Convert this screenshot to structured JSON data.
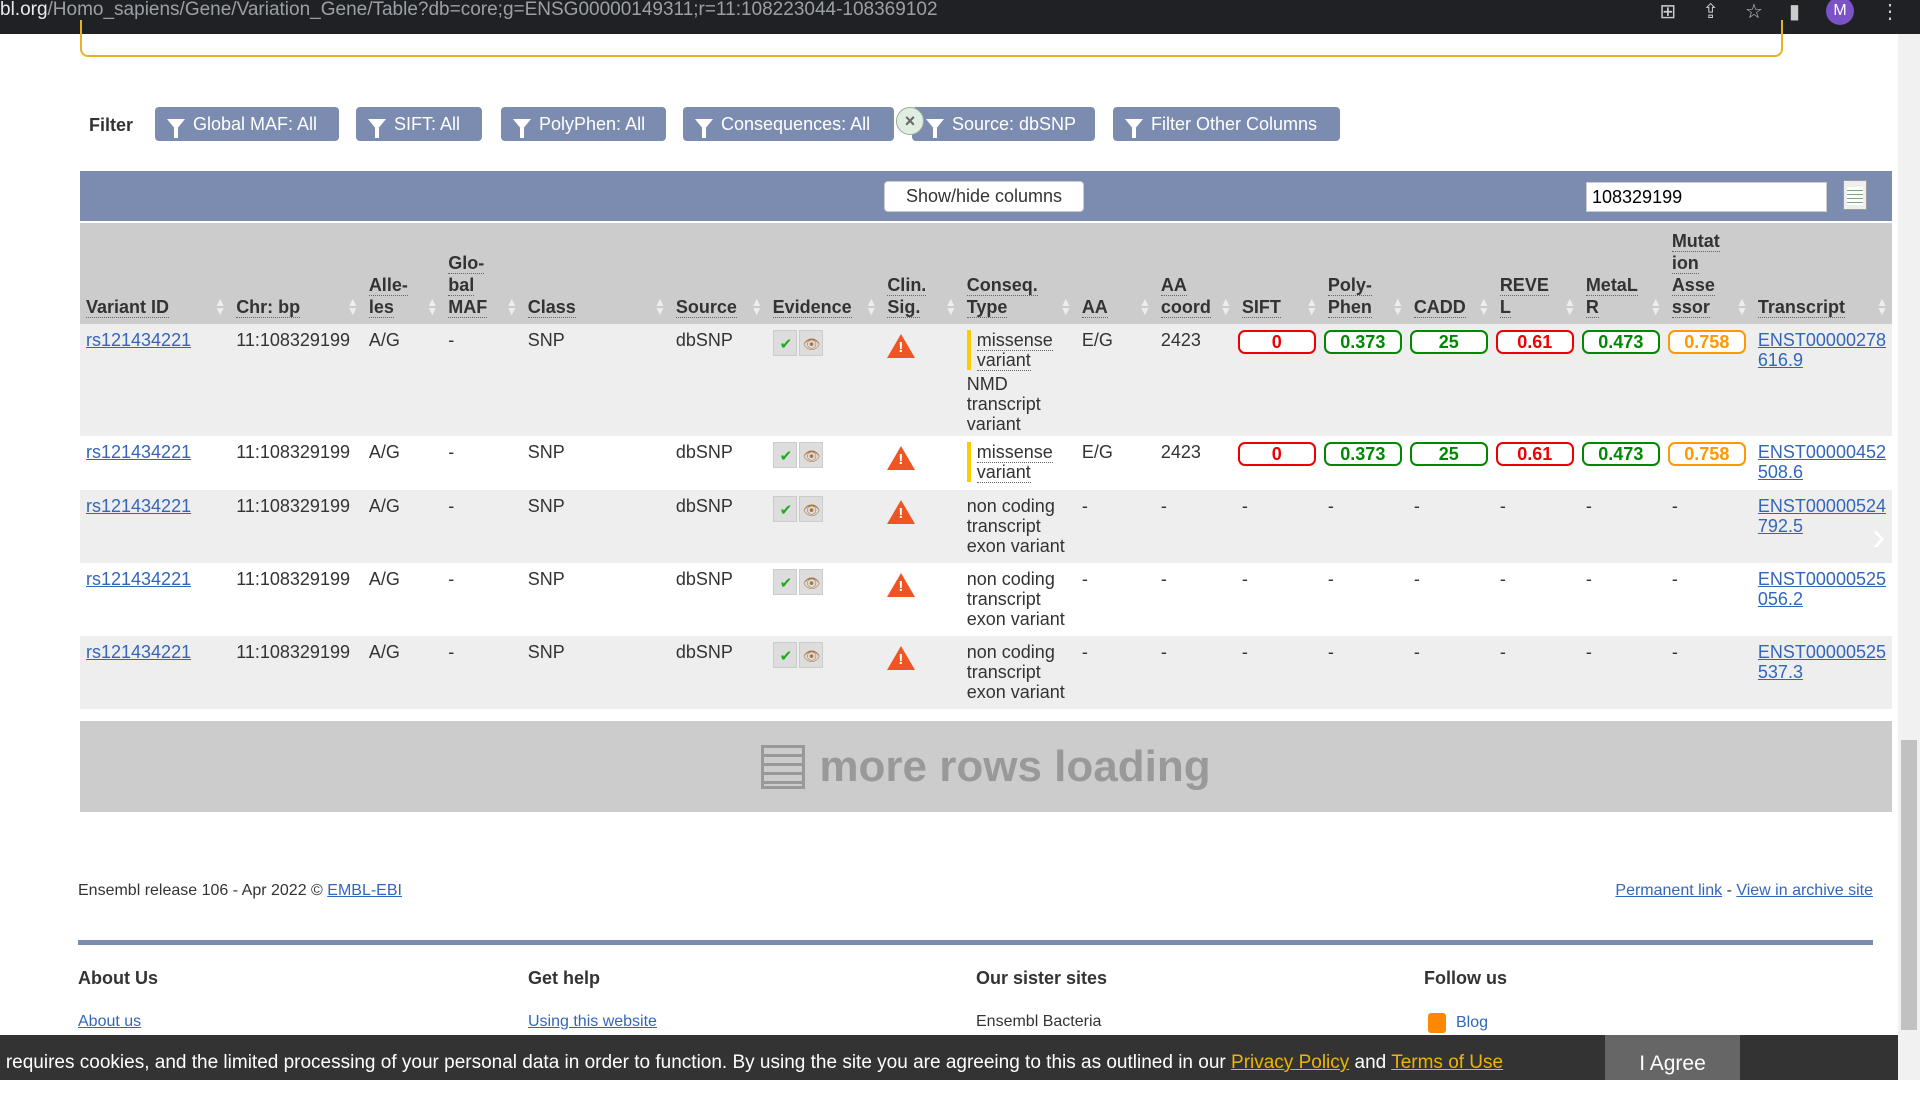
{
  "browser": {
    "url_host": "bl.org",
    "url_path": "/Homo_sapiens/Gene/Variation_Gene/Table?db=core;g=ENSG00000149311;r=11:108223044-108369102",
    "avatar": "M"
  },
  "filter": {
    "label": "Filter",
    "buttons": [
      "Global MAF: All",
      "SIFT: All",
      "PolyPhen: All",
      "Consequences: All",
      "Source: dbSNP",
      "Filter Other Columns"
    ]
  },
  "toolbar": {
    "show_hide": "Show/hide columns",
    "search_value": "108329199"
  },
  "table": {
    "headers": [
      [
        "Variant ID"
      ],
      [
        "Chr: bp"
      ],
      [
        "Alle-",
        "les"
      ],
      [
        "Glo-",
        "bal",
        "MAF"
      ],
      [
        "Class"
      ],
      [
        "Source"
      ],
      [
        "Evidence"
      ],
      [
        "Clin.",
        "Sig."
      ],
      [
        "Conseq.",
        "Type"
      ],
      [
        "AA"
      ],
      [
        "AA",
        "coord"
      ],
      [
        "SIFT"
      ],
      [
        "Poly-",
        "Phen"
      ],
      [
        "CADD"
      ],
      [
        "REVE",
        "L"
      ],
      [
        "MetaL",
        "R"
      ],
      [
        "Mutat",
        "ion",
        "Asse",
        "ssor"
      ],
      [
        "Transcript"
      ]
    ],
    "rows": [
      {
        "id": "rs121434221",
        "chr": "11:108329199",
        "alleles": "A/G",
        "maf": "-",
        "class": "SNP",
        "source": "dbSNP",
        "conseq": [
          "missense variant"
        ],
        "conseq_extra": "NMD transcript variant",
        "aa": "E/G",
        "aa_coord": "2423",
        "sift": "0",
        "polyphen": "0.373",
        "cadd": "25",
        "revel": "0.61",
        "metalr": "0.473",
        "ma": "0.758",
        "transcript": [
          "ENST00000278",
          "616.9"
        ]
      },
      {
        "id": "rs121434221",
        "chr": "11:108329199",
        "alleles": "A/G",
        "maf": "-",
        "class": "SNP",
        "source": "dbSNP",
        "conseq": [
          "missense variant"
        ],
        "conseq_extra": "",
        "aa": "E/G",
        "aa_coord": "2423",
        "sift": "0",
        "polyphen": "0.373",
        "cadd": "25",
        "revel": "0.61",
        "metalr": "0.473",
        "ma": "0.758",
        "transcript": [
          "ENST00000452",
          "508.6"
        ]
      },
      {
        "id": "rs121434221",
        "chr": "11:108329199",
        "alleles": "A/G",
        "maf": "-",
        "class": "SNP",
        "source": "dbSNP",
        "conseq_plain": "non coding transcript exon variant",
        "aa": "-",
        "aa_coord": "-",
        "sift": "-",
        "polyphen": "-",
        "cadd": "-",
        "revel": "-",
        "metalr": "-",
        "ma": "-",
        "transcript": [
          "ENST00000524",
          "792.5"
        ]
      },
      {
        "id": "rs121434221",
        "chr": "11:108329199",
        "alleles": "A/G",
        "maf": "-",
        "class": "SNP",
        "source": "dbSNP",
        "conseq_plain": "non coding transcript exon variant",
        "aa": "-",
        "aa_coord": "-",
        "sift": "-",
        "polyphen": "-",
        "cadd": "-",
        "revel": "-",
        "metalr": "-",
        "ma": "-",
        "transcript": [
          "ENST00000525",
          "056.2"
        ]
      },
      {
        "id": "rs121434221",
        "chr": "11:108329199",
        "alleles": "A/G",
        "maf": "-",
        "class": "SNP",
        "source": "dbSNP",
        "conseq_plain": "non coding transcript exon variant",
        "aa": "-",
        "aa_coord": "-",
        "sift": "-",
        "polyphen": "-",
        "cadd": "-",
        "revel": "-",
        "metalr": "-",
        "ma": "-",
        "transcript": [
          "ENST00000525",
          "537.3"
        ]
      }
    ],
    "score_colors": {
      "sift": "#e00",
      "polyphen": "#080",
      "cadd": "#080",
      "revel": "#e00",
      "metalr": "#080",
      "ma": "#f90"
    },
    "loading": "more rows loading"
  },
  "footer": {
    "release": "Ensembl release 106 - Apr 2022 © ",
    "embl": "EMBL-EBI",
    "permanent": "Permanent link",
    "sep": " - ",
    "archive": "View in archive site",
    "cols": [
      {
        "title": "About Us",
        "link": "About us"
      },
      {
        "title": "Get help",
        "link": "Using this website"
      },
      {
        "title": "Our sister sites",
        "link": "Ensembl Bacteria"
      },
      {
        "title": "Follow us",
        "link": "Blog"
      }
    ]
  },
  "cookie": {
    "text": "e requires cookies, and the limited processing of your personal data in order to function. By using the site you are agreeing to this as outlined in our ",
    "privacy": "Privacy Policy",
    "and": " and ",
    "terms": "Terms of Use",
    "agree": "I Agree"
  }
}
